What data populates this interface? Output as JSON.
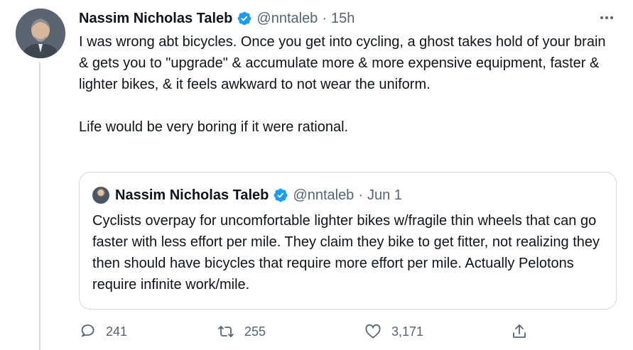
{
  "tweet": {
    "author_name": "Nassim Nicholas Taleb",
    "handle": "@nntaleb",
    "separator": "·",
    "time": "15h",
    "text": "I was wrong abt bicycles. Once you get into cycling, a ghost takes hold of your brain & gets you to \"upgrade\" & accumulate more & more expensive equipment, faster & lighter bikes, & it feels awkward to not wear the uniform.\n\nLife would be very boring if it were rational."
  },
  "quote": {
    "author_name": "Nassim Nicholas Taleb",
    "handle": "@nntaleb",
    "separator": "·",
    "time": "Jun 1",
    "text": "Cyclists overpay for uncomfortable lighter bikes w/fragile thin wheels that can go faster with less effort per mile. They claim they bike to get fitter, not realizing they then should have bicycles that require more effort per mile.  Actually Pelotons require infinite work/mile."
  },
  "actions": {
    "replies": "241",
    "retweets": "255",
    "likes": "3,171"
  },
  "colors": {
    "text": "#0f1419",
    "secondary": "#536471",
    "verified": "#1d9bf0",
    "border": "#cfd9de"
  },
  "icons": {
    "verified": "verified-badge-icon",
    "more": "more-horizontal-icon",
    "reply": "reply-icon",
    "retweet": "retweet-icon",
    "like": "like-icon",
    "share": "share-icon"
  }
}
